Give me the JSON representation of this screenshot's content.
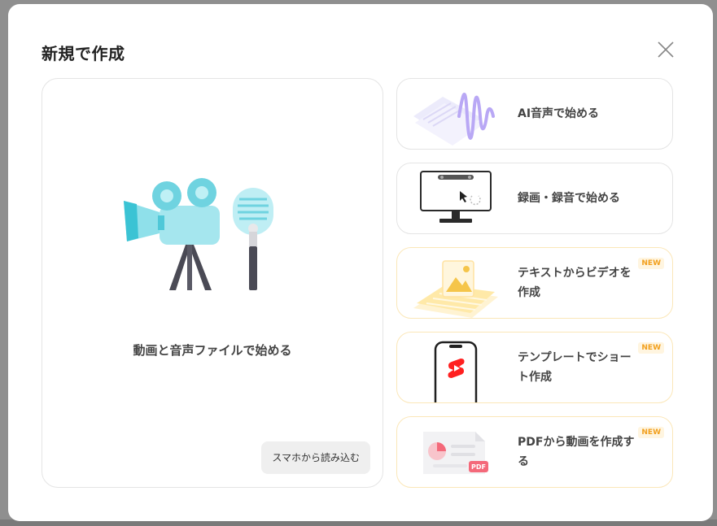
{
  "dialog": {
    "title": "新規で作成"
  },
  "main_option": {
    "label": "動画と音声ファイルで始める",
    "phone_button": "スマホから読み込む"
  },
  "options": [
    {
      "label": "AI音声で始める",
      "badge": ""
    },
    {
      "label": "録画・録音で始める",
      "badge": ""
    },
    {
      "label": "テキストからビデオを作成",
      "badge": "NEW"
    },
    {
      "label": "テンプレートでショート作成",
      "badge": "NEW"
    },
    {
      "label": "PDFから動画を作成する",
      "badge": "NEW",
      "thumb_tag": "PDF"
    }
  ],
  "icons": [
    "close-icon",
    "camera-mic-illustration",
    "ai-voice-illustration",
    "screen-record-illustration",
    "text-to-video-illustration",
    "short-phone-illustration",
    "pdf-illustration"
  ],
  "colors": {
    "accent": "#f2a01e",
    "new_border": "#fbe7b8",
    "illus_teal": "#6fd3e0",
    "pdf_pink": "#f4697a"
  }
}
